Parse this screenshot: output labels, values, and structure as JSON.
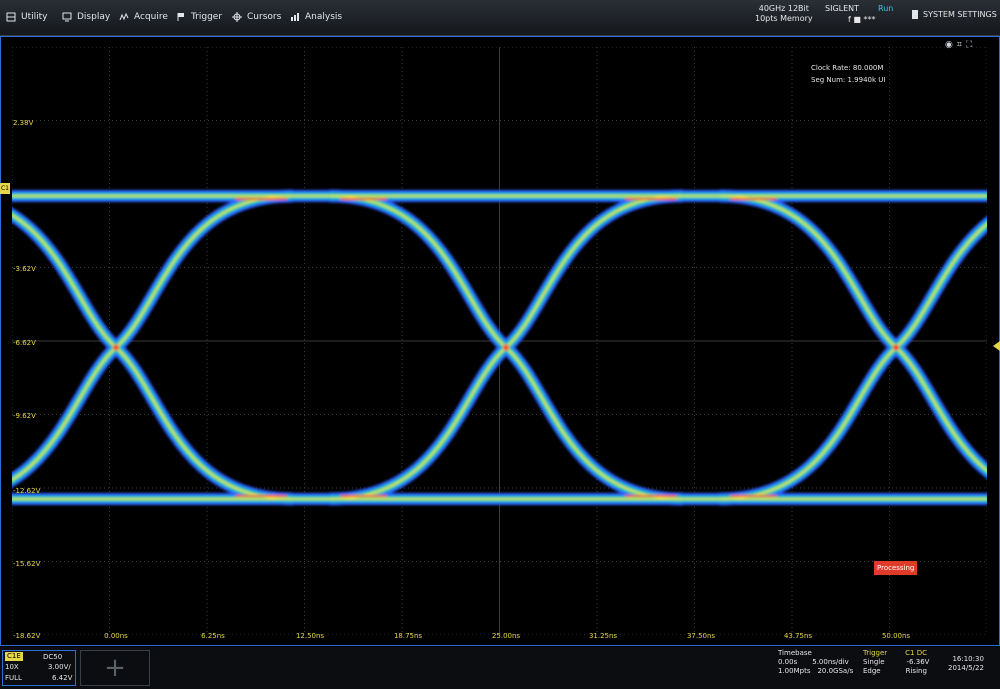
{
  "menu": {
    "items": [
      {
        "label": "Utility",
        "icon": "utility-icon"
      },
      {
        "label": "Display",
        "icon": "display-icon"
      },
      {
        "label": "Acquire",
        "icon": "acquire-icon"
      },
      {
        "label": "Trigger",
        "icon": "trigger-flag-icon"
      },
      {
        "label": "Cursors",
        "icon": "cursors-icon"
      },
      {
        "label": "Analysis",
        "icon": "analysis-icon"
      }
    ],
    "sample_rate": "40GHz 12Bit",
    "memory": "10pts Memory",
    "brand": "SIGLENT",
    "run_state": "Run",
    "trigger_status": "f ■ ***",
    "system_settings": "SYSTEM SETTINGS"
  },
  "scope": {
    "y_labels": [
      "2.38V",
      "-3.62V",
      "-6.62V",
      "-9.62V",
      "-12.62V",
      "-15.62V",
      "-18.62V"
    ],
    "x_labels": [
      "0.00ns",
      "6.25ns",
      "12.50ns",
      "18.75ns",
      "25.00ns",
      "31.25ns",
      "37.50ns",
      "43.75ns",
      "50.00ns"
    ],
    "info_line1": "Clock Rate: 80.000M",
    "info_line2": "Seg Num: 1.9940k UI",
    "processing": "Processing",
    "channel_marker": "C1",
    "tools": [
      "◉",
      "⌗",
      "⛶"
    ]
  },
  "bottom": {
    "ch1": {
      "tag": "C1E",
      "coupling": "DC50",
      "probe": "10X",
      "scale": "3.00V/",
      "bw": "FULL",
      "offset": "6.42V"
    },
    "add_label": "+",
    "timebase": {
      "title": "Timebase",
      "delay": "0.00s",
      "scale": "5.00ns/div",
      "points": "1.00Mpts",
      "rate": "20.0GSa/s"
    },
    "trigger": {
      "title": "Trigger",
      "source": "C1 DC",
      "mode": "Single",
      "level": "-6.36V",
      "type": "Edge",
      "slope": "Rising"
    },
    "clock": {
      "time": "16:10:30",
      "date": "2014/5/22"
    }
  },
  "colors": {
    "grid": "#3a3a3a",
    "axis_text": "#e6d64a",
    "frame": "#2d6fd6",
    "trace_outer": "#2b5cff",
    "trace_mid": "#24d68a",
    "trace_core": "#f3e64a",
    "trace_hot": "#ff3a2a"
  }
}
